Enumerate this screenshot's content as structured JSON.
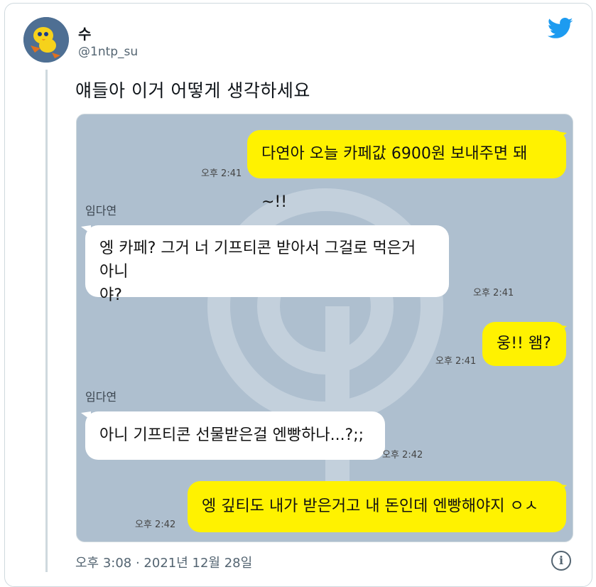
{
  "user": {
    "name": "수",
    "handle": "@1ntp_su"
  },
  "tweet": {
    "text": "얘들아 이거 어떻게 생각하세요"
  },
  "chat": {
    "messages": [
      {
        "text": "다연아 오늘 카페값 6900원 보내주면 돼~!!",
        "time": "오후 2:41"
      },
      {
        "sender": "임다연",
        "line1": "엥 카페? 그거 너 기프티콘 받아서 그걸로 먹은거 아니",
        "line2": "야?",
        "time": "오후 2:41"
      },
      {
        "text": "웅!! 왬?",
        "time": "오후 2:41"
      },
      {
        "sender": "임다연",
        "text": "아니 기프티콘 선물받은걸 엔빵하나...?;;",
        "time": "오후 2:42"
      },
      {
        "text": "엥 깊티도 내가 받은거고 내 돈인데 엔빵해야지 ㅇㅅㅇ",
        "time": "오후 2:42"
      }
    ]
  },
  "footer": {
    "timestamp": "오후 3:08 · 2021년 12월 28일",
    "info_label": "i"
  },
  "colors": {
    "me_bubble": "#fff200",
    "them_bubble": "#ffffff",
    "chat_bg": "#aebfcf",
    "twitter_blue": "#1d9bf0"
  },
  "icons": {
    "bird": "twitter-bird-icon",
    "info": "info-icon"
  }
}
